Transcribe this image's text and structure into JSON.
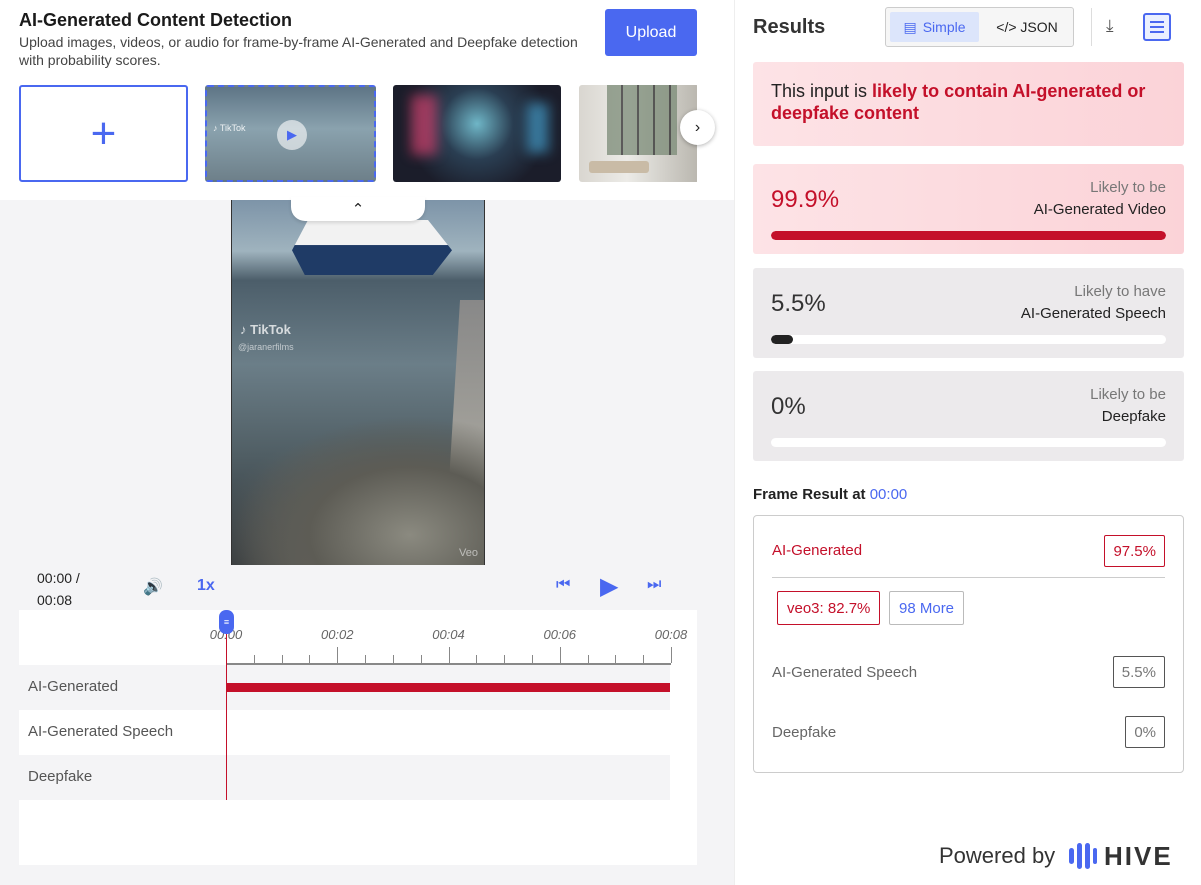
{
  "header": {
    "title": "AI-Generated Content Detection",
    "subtitle": "Upload images, videos, or audio for frame-by-frame AI-Generated and Deepfake detection with probability scores.",
    "upload_label": "Upload"
  },
  "thumbnails": {
    "add_label": "+",
    "first_watermark": "♪ TikTok",
    "next_arrow": "›"
  },
  "video": {
    "watermark": "♪ TikTok",
    "handle": "@jaranerfilms",
    "veo": "Veo",
    "collapse_arrow": "⌃"
  },
  "player": {
    "time": "00:00 / 00:08",
    "volume_icon": "🔊",
    "speed": "1x",
    "skip_back_icon": "⏮",
    "play_icon": "▶",
    "skip_forward_icon": "⏭",
    "scrub_icon": "≡",
    "ticks": [
      "00:00",
      "00:02",
      "00:04",
      "00:06",
      "00:08"
    ],
    "tracks": [
      {
        "label": "AI-Generated",
        "coverage": 1.0
      },
      {
        "label": "AI-Generated Speech",
        "coverage": 0
      },
      {
        "label": "Deepfake",
        "coverage": 0
      }
    ]
  },
  "results": {
    "title": "Results",
    "toggle_simple": "Simple",
    "toggle_json": "</> JSON",
    "simple_icon": "▤",
    "download_icon": "⤓",
    "alert_prefix": "This input is ",
    "alert_highlight": "likely to contain AI-generated or deepfake content",
    "cards": [
      {
        "pct": "99.9%",
        "line1": "Likely to be",
        "line2": "AI-Generated Video",
        "value": 0.999,
        "style": "red"
      },
      {
        "pct": "5.5%",
        "line1": "Likely to have",
        "line2": "AI-Generated Speech",
        "value": 0.055,
        "style": "gray"
      },
      {
        "pct": "0%",
        "line1": "Likely to be",
        "line2": "Deepfake",
        "value": 0,
        "style": "gray"
      }
    ],
    "frame_title": "Frame Result at ",
    "frame_time": "00:00",
    "frame": {
      "ai_label": "AI-Generated",
      "ai_value": "97.5%",
      "chip_model": "veo3: 82.7%",
      "chip_more": "98 More",
      "speech_label": "AI-Generated Speech",
      "speech_value": "5.5%",
      "deepfake_label": "Deepfake",
      "deepfake_value": "0%"
    },
    "powered_by": "Powered by",
    "brand": "HIVE"
  },
  "colors": {
    "accent": "#4a68f0",
    "danger": "#c4102a"
  }
}
